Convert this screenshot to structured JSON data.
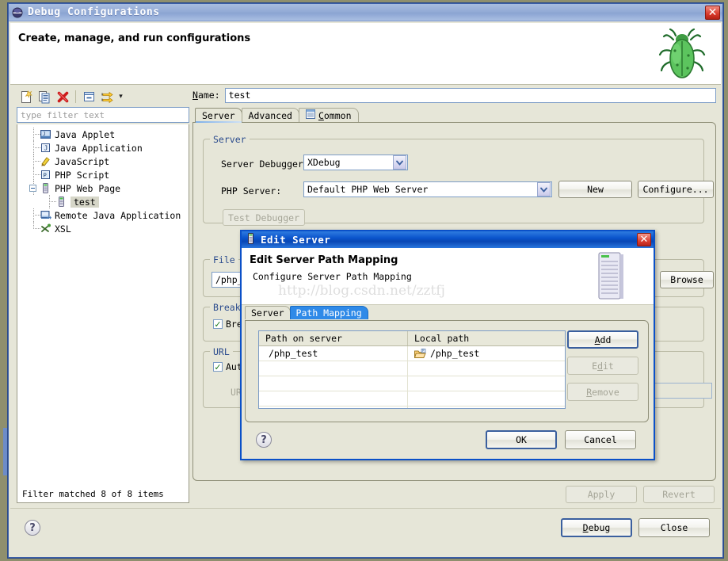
{
  "window": {
    "title": "Debug Configurations",
    "title_icon": "debug-eclipse-icon",
    "close_label": "✕",
    "banner_title": "Create, manage, and run configurations",
    "banner_icon": "green-bug-icon"
  },
  "tree_toolbar": {
    "buttons": [
      {
        "name": "new-launch-configuration-icon",
        "label": ""
      },
      {
        "name": "duplicate-launch-configuration-icon",
        "label": ""
      },
      {
        "name": "delete-launch-configuration-icon",
        "label": ""
      },
      {
        "name": "collapse-all-icon",
        "label": ""
      },
      {
        "name": "filter-launch-configurations-icon",
        "label": ""
      }
    ],
    "dropdown_arrow": "▾"
  },
  "filter": {
    "placeholder": "type filter text",
    "value": "",
    "status": "Filter matched 8 of 8 items"
  },
  "tree": {
    "items": [
      {
        "label": "Java Applet",
        "icon": "java-applet-icon",
        "indent": 0,
        "expander": "none",
        "selected": false
      },
      {
        "label": "Java Application",
        "icon": "java-application-icon",
        "indent": 0,
        "expander": "none",
        "selected": false
      },
      {
        "label": "JavaScript",
        "icon": "javascript-icon",
        "indent": 0,
        "expander": "none",
        "selected": false
      },
      {
        "label": "PHP Script",
        "icon": "php-script-icon",
        "indent": 0,
        "expander": "none",
        "selected": false
      },
      {
        "label": "PHP Web Page",
        "icon": "php-web-page-icon",
        "indent": 0,
        "expander": "expanded",
        "selected": false
      },
      {
        "label": "test",
        "icon": "php-web-page-icon",
        "indent": 1,
        "expander": "none",
        "selected": true
      },
      {
        "label": "Remote Java Application",
        "icon": "remote-java-application-icon",
        "indent": 0,
        "expander": "none",
        "selected": false
      },
      {
        "label": "XSL",
        "icon": "xsl-icon",
        "indent": 0,
        "expander": "none",
        "selected": false
      }
    ]
  },
  "config": {
    "name_label": "Name:",
    "name_value": "test",
    "tabs": [
      {
        "label": "Server",
        "icon": "",
        "active": true
      },
      {
        "label": "Advanced",
        "icon": "",
        "active": false
      },
      {
        "label": "Common",
        "icon": "common-tab-icon",
        "active": false
      }
    ],
    "server_group": {
      "title": "Server",
      "server_debugger_label": "Server Debugger:",
      "server_debugger_value": "XDebug",
      "php_server_label": "PHP Server:",
      "php_server_value": "Default PHP Web Server",
      "new_button": "New",
      "configure_button": "Configure...",
      "test_debugger_button": "Test Debugger"
    },
    "file_group": {
      "title": "File",
      "file_value": "/php_te",
      "browse_button": "Browse"
    },
    "breakpoint_group": {
      "title": "Breakpo",
      "checkbox_label": "Break",
      "checked": true
    },
    "url_group": {
      "title": "URL",
      "auto_label": "Auto",
      "auto_checked": true,
      "url_label": "URL:",
      "url_value": ""
    },
    "apply_button": "Apply",
    "revert_button": "Revert"
  },
  "footer": {
    "help_icon": "?",
    "debug_button": "Debug",
    "close_button": "Close"
  },
  "modal": {
    "title": "Edit Server",
    "title_icon": "server-icon",
    "close_label": "✕",
    "heading": "Edit Server Path Mapping",
    "subheading": "Configure Server Path Mapping",
    "watermark": "http://blog.csdn.net/zztfj",
    "banner_icon": "server-tower-icon",
    "tabs": [
      {
        "label": "Server",
        "active": false
      },
      {
        "label": "Path Mapping",
        "active": true
      }
    ],
    "table": {
      "columns": [
        "Path on server",
        "Local path"
      ],
      "rows": [
        {
          "path_on_server": "/php_test",
          "local_path": "/php_test",
          "local_icon": "php-folder-icon"
        },
        {
          "path_on_server": "",
          "local_path": "",
          "local_icon": ""
        },
        {
          "path_on_server": "",
          "local_path": "",
          "local_icon": ""
        },
        {
          "path_on_server": "",
          "local_path": "",
          "local_icon": ""
        },
        {
          "path_on_server": "",
          "local_path": "",
          "local_icon": ""
        }
      ]
    },
    "side_buttons": [
      {
        "label": "Add",
        "enabled": true,
        "mnemonic_index": 0
      },
      {
        "label": "Edit",
        "enabled": false,
        "mnemonic_index": 1
      },
      {
        "label": "Remove",
        "enabled": false,
        "mnemonic_index": 0
      }
    ],
    "help_icon": "?",
    "ok_button": "OK",
    "cancel_button": "Cancel"
  },
  "colors": {
    "window_bg": "#e6e6d8",
    "title_gradient_top": "#a8bde0",
    "modal_title_blue": "#0a54cc",
    "accent_blue": "#2a4b8d",
    "desktop_bg": "#8f8f6e",
    "white": "#ffffff",
    "close_red": "#d9392c"
  }
}
